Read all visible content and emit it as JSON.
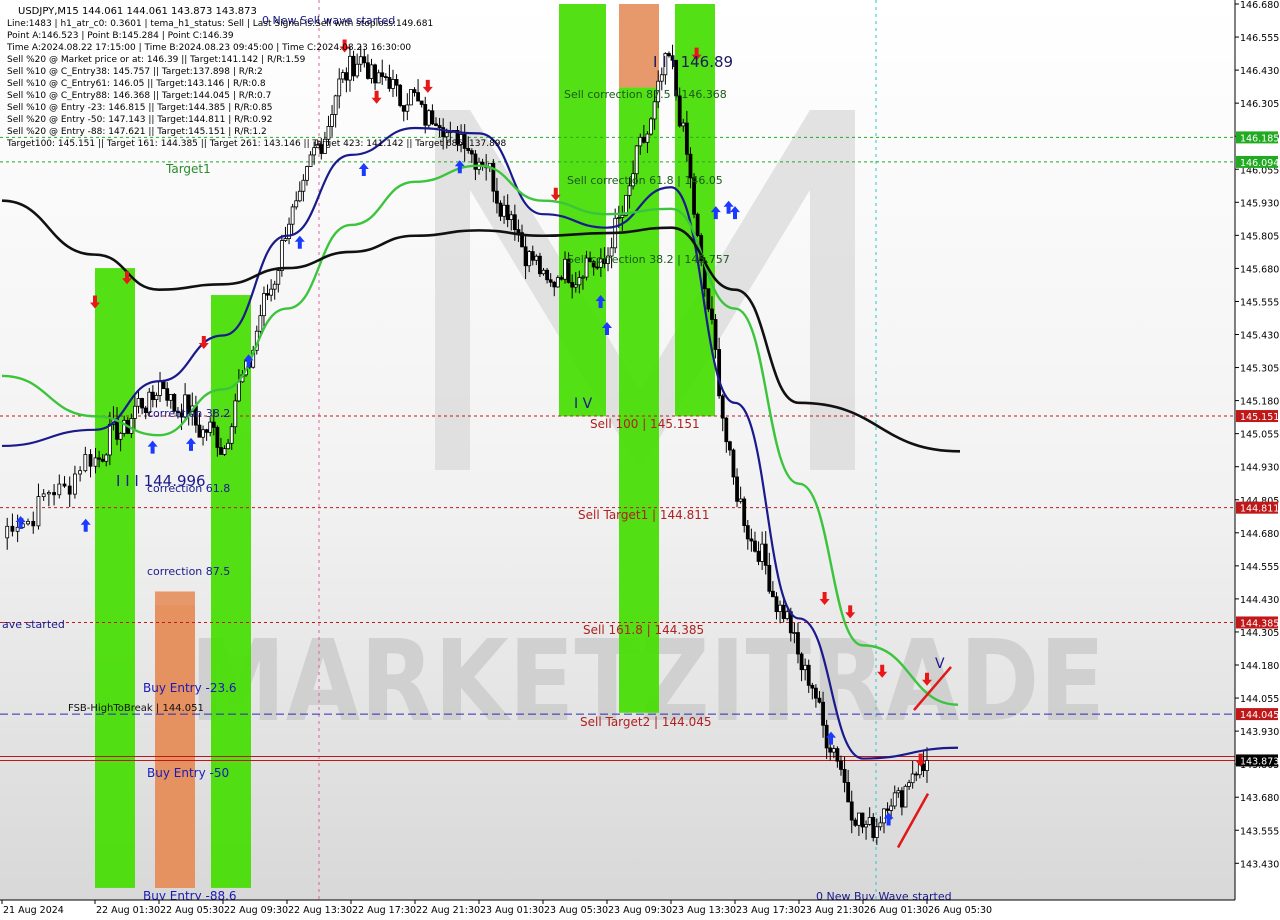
{
  "window": {
    "title": "USDJPY,M15  144.061 144.061 143.873 143.873"
  },
  "info_panel": [
    "Line:1483 | h1_atr_c0: 0.3601 | tema_h1_status: Sell | Last Signal is:Sell with stoploss:149.681",
    "Point A:146.523 | Point B:145.284 | Point C:146.39",
    "Time A:2024.08.22 17:15:00 | Time B:2024.08.23 09:45:00 | Time C:2024.08.23 16:30:00",
    "Sell %20 @ Market price or at: 146.39 || Target:141.142 | R/R:1.59",
    "Sell %10 @ C_Entry38: 145.757 || Target:137.898 | R/R:2",
    "Sell %10 @ C_Entry61: 146.05 || Target:143.146 | R/R:0.8",
    "Sell %10 @ C_Entry88: 146.368 || Target:144.045 | R/R:0.7",
    "Sell %10 @ Entry -23: 146.815 || Target:144.385 | R/R:0.85",
    "Sell %20 @ Entry -50: 147.143 || Target:144.811 | R/R:0.92",
    "Sell %20 @ Entry -88: 147.621 || Target:145.151 | R/R:1.2",
    "Target100: 145.151 || Target 161: 144.385 || Target 261: 143.146 || Target 423: 141.142 || Target 685: 137.898"
  ],
  "watermark": "MARKETZITRADE",
  "price_axis": {
    "ticks": [
      "146.680",
      "146.555",
      "146.430",
      "146.305",
      "146.180",
      "146.055",
      "145.930",
      "145.805",
      "145.680",
      "145.555",
      "145.430",
      "145.305",
      "145.180",
      "145.055",
      "144.930",
      "144.805",
      "144.680",
      "144.555",
      "144.430",
      "144.305",
      "144.180",
      "144.055",
      "143.930",
      "143.805",
      "143.680",
      "143.555",
      "143.430"
    ],
    "tags": [
      {
        "label": "146.185",
        "color": "#22aa22"
      },
      {
        "label": "146.094",
        "color": "#22aa22"
      },
      {
        "label": "145.151",
        "color": "#c01818"
      },
      {
        "label": "144.811",
        "color": "#c01818"
      },
      {
        "label": "144.385",
        "color": "#c01818"
      },
      {
        "label": "144.045",
        "color": "#c01818"
      },
      {
        "label": "143.873",
        "color": "#000000"
      }
    ]
  },
  "time_axis": [
    "21 Aug 2024",
    "22 Aug 01:30",
    "22 Aug 05:30",
    "22 Aug 09:30",
    "22 Aug 13:30",
    "22 Aug 17:30",
    "22 Aug 21:30",
    "23 Aug 01:30",
    "23 Aug 05:30",
    "23 Aug 09:30",
    "23 Aug 13:30",
    "23 Aug 17:30",
    "23 Aug 21:30",
    "26 Aug 01:30",
    "26 Aug 05:30"
  ],
  "annotations": {
    "sell_wave": "0 New Sell wave started",
    "buy_wave": "0 New Buy Wave started",
    "wave_left": "ave started",
    "target1": "Target1",
    "wave_iii_high": "I I I 146.89",
    "wave_iii_low": "I I I 144.996",
    "wave_iv": "I V",
    "wave_v": "V",
    "correction_382": "correction 38.2",
    "correction_618": "correction 61.8",
    "correction_875": "correction 87.5",
    "sell_corr_875": "Sell correction 87.5 | 146.368",
    "sell_corr_618": "Sell correction 61.8 | 146.05",
    "sell_corr_382": "Sell correction 38.2 | 145.757",
    "sell_100": "Sell 100 | 145.151",
    "sell_target1": "Sell Target1 | 144.811",
    "sell_1618": "Sell 161.8 | 144.385",
    "sell_target2": "Sell Target2 | 144.045",
    "buy_entry_236": "Buy Entry -23.6",
    "buy_entry_50": "Buy Entry -50",
    "buy_entry_886": "Buy Entry -88.6",
    "fsb": "FSB-HighToBreak | 144.051",
    "h_lines": [
      {
        "label": "146.185",
        "color": "#22aa22"
      },
      {
        "label": "146.094",
        "color": "#22aa22"
      },
      {
        "label": "145.151",
        "color": "#c01818"
      },
      {
        "label": "144.811",
        "color": "#c01818"
      },
      {
        "label": "144.385",
        "color": "#c01818"
      },
      {
        "label": "144.045",
        "color": "#2a2ab8"
      }
    ]
  },
  "chart_data": {
    "type": "line",
    "title": "USDJPY,M15",
    "ylim": [
      143.37,
      146.68
    ],
    "x": [
      "21 Aug 2024",
      "22 Aug 01:30",
      "22 Aug 05:30",
      "22 Aug 09:30",
      "22 Aug 13:30",
      "22 Aug 17:30",
      "22 Aug 21:30",
      "23 Aug 01:30",
      "23 Aug 05:30",
      "23 Aug 09:30",
      "23 Aug 13:30",
      "23 Aug 17:30",
      "23 Aug 21:30",
      "26 Aug 01:30",
      "26 Aug 05:30"
    ],
    "series": [
      {
        "values": [
          144.7,
          145.0,
          145.26,
          145.04,
          145.84,
          146.48,
          146.31,
          146.12,
          145.65,
          145.73,
          146.5,
          144.86,
          144.27,
          143.6,
          143.873
        ]
      },
      {
        "values": [
          145.04,
          145.1,
          145.28,
          145.45,
          145.82,
          146.12,
          146.22,
          146.2,
          145.9,
          145.85,
          146.0,
          145.2,
          144.4,
          143.88,
          143.92
        ]
      },
      {
        "values": [
          145.3,
          145.15,
          145.08,
          145.25,
          145.55,
          145.86,
          146.02,
          146.08,
          145.95,
          145.9,
          145.92,
          145.55,
          144.9,
          144.3,
          144.08
        ]
      },
      {
        "values": [
          145.95,
          145.75,
          145.62,
          145.64,
          145.7,
          145.76,
          145.82,
          145.84,
          145.82,
          145.83,
          145.85,
          145.62,
          145.2,
          null,
          null
        ]
      }
    ],
    "h_levels": [
      146.185,
      146.094,
      145.151,
      144.811,
      144.385,
      144.045,
      143.873
    ],
    "zones": [
      {
        "color": "#44dd00",
        "y_range": [
          143.4,
          145.7
        ]
      },
      {
        "color": "#e69060",
        "y_range": [
          143.4,
          144.45
        ]
      },
      {
        "color": "#44dd00",
        "y_range": [
          143.4,
          145.6
        ]
      },
      {
        "color": "#e69060",
        "y_range": [
          143.4,
          144.5
        ]
      },
      {
        "color": "#44dd00",
        "y_range": [
          145.15,
          146.68
        ]
      },
      {
        "color": "#e69060",
        "y_range": [
          146.37,
          146.68
        ]
      },
      {
        "color": "#44dd00",
        "y_range": [
          144.05,
          146.37
        ]
      },
      {
        "color": "#44dd00",
        "y_range": [
          145.15,
          146.68
        ]
      }
    ],
    "colors": {
      "price": "#000000",
      "tema_fast": "#1a1a8c",
      "tema_slow": "#3cc43c",
      "ma_long": "#111111"
    }
  }
}
